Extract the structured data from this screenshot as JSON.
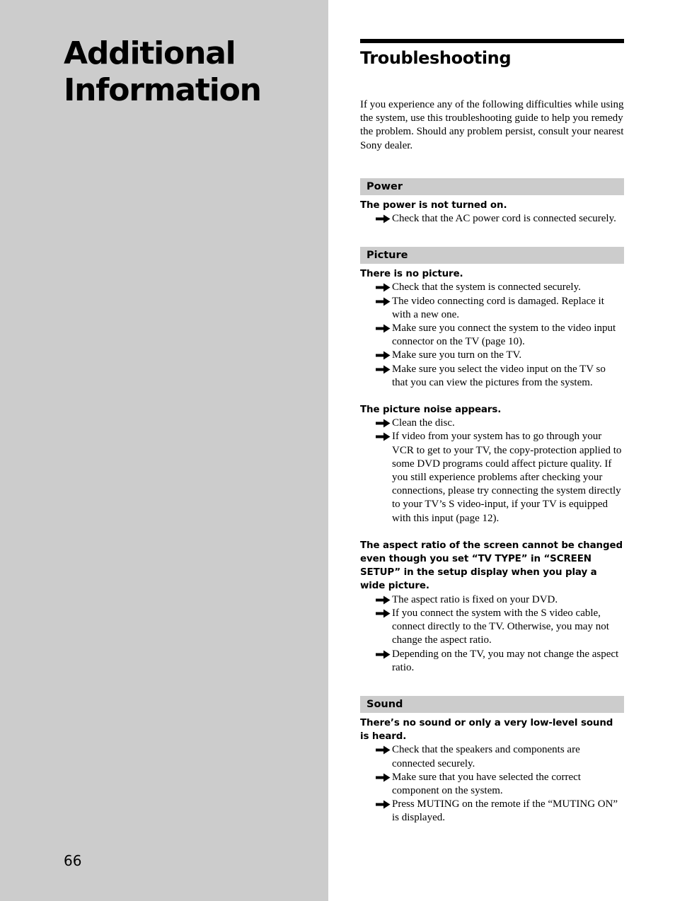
{
  "left_panel": {
    "chapter_title_line1": "Additional",
    "chapter_title_line2": "Information",
    "page_number": "66"
  },
  "main": {
    "title": "Troubleshooting",
    "intro": "If you experience any of the following difficulties while using the system, use this troubleshooting guide to help you remedy the problem.  Should any problem persist, consult your nearest Sony dealer.",
    "icon": "right-arrow-icon",
    "sections": [
      {
        "header": "Power",
        "problems": [
          {
            "title": "The power is not turned on.",
            "solutions": [
              "Check that the AC power cord is connected securely."
            ]
          }
        ]
      },
      {
        "header": "Picture",
        "problems": [
          {
            "title": "There is no picture.",
            "solutions": [
              "Check that the system is connected securely.",
              "The video connecting cord is damaged.  Replace it with a new one.",
              "Make sure you connect the system to the video input connector on the TV (page 10).",
              "Make sure you turn on the TV.",
              "Make sure you select the video input on the TV so that you can view the pictures from the system."
            ]
          },
          {
            "title": "The picture noise appears.",
            "solutions": [
              "Clean the disc.",
              "If video from your system has to go through your VCR to get to your TV, the copy-protection applied to some DVD programs could affect picture quality.  If you still experience problems after checking your connections, please try connecting the system directly to your TV’s S video-input, if your TV is equipped with this input  (page 12)."
            ]
          },
          {
            "title": "The aspect ratio of the screen cannot be changed even though you set “TV TYPE” in “SCREEN SETUP” in the setup display when you play a wide picture.",
            "solutions": [
              "The aspect ratio is fixed on your DVD.",
              "If you connect the system with the S video cable, connect directly to the TV.  Otherwise, you may not change the aspect ratio.",
              "Depending on the TV, you may not change the aspect ratio."
            ]
          }
        ]
      },
      {
        "header": "Sound",
        "problems": [
          {
            "title": "There’s no sound or only a very low-level sound is heard.",
            "solutions": [
              "Check that the speakers and components are connected securely.",
              "Make sure that you have selected the correct component on the system.",
              "Press MUTING on the remote if the “MUTING ON” is displayed."
            ]
          }
        ]
      }
    ]
  }
}
